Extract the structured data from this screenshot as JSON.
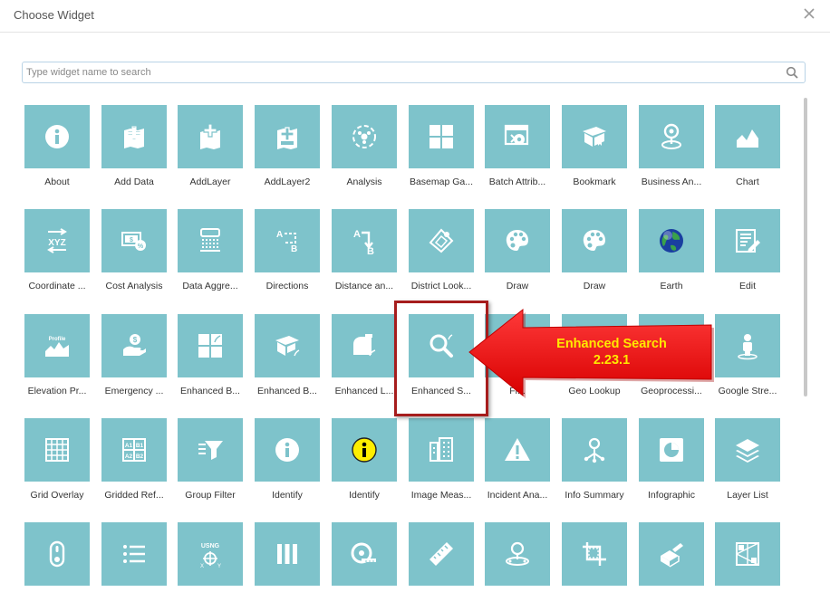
{
  "dialog": {
    "title": "Choose Widget"
  },
  "search": {
    "placeholder": "Type widget name to search"
  },
  "callout": {
    "line1": "Enhanced Search",
    "line2": "2.23.1"
  },
  "colors": {
    "tile": "#7ec3cb",
    "highlight_border": "#a61d1d",
    "arrow": "#ee1111",
    "callout_text": "#ffe900"
  },
  "widgets": [
    {
      "label": "About",
      "icon": "info-icon"
    },
    {
      "label": "Add Data",
      "icon": "add-data-map-icon"
    },
    {
      "label": "AddLayer",
      "icon": "add-layer-icon"
    },
    {
      "label": "AddLayer2",
      "icon": "add-layer2-icon"
    },
    {
      "label": "Analysis",
      "icon": "analysis-icon"
    },
    {
      "label": "Basemap Ga...",
      "icon": "basemap-gallery-icon"
    },
    {
      "label": "Batch Attrib...",
      "icon": "batch-attribute-icon"
    },
    {
      "label": "Bookmark",
      "icon": "bookmark-icon"
    },
    {
      "label": "Business An...",
      "icon": "business-analyst-icon"
    },
    {
      "label": "Chart",
      "icon": "chart-icon"
    },
    {
      "label": "Coordinate ...",
      "icon": "coordinate-xyz-icon"
    },
    {
      "label": "Cost Analysis",
      "icon": "cost-analysis-icon"
    },
    {
      "label": "Data Aggre...",
      "icon": "data-aggregation-icon"
    },
    {
      "label": "Directions",
      "icon": "directions-icon"
    },
    {
      "label": "Distance an...",
      "icon": "distance-icon"
    },
    {
      "label": "District Look...",
      "icon": "district-lookup-icon"
    },
    {
      "label": "Draw",
      "icon": "palette-icon"
    },
    {
      "label": "Draw",
      "icon": "palette-icon"
    },
    {
      "label": "Earth",
      "icon": "earth-globe-icon"
    },
    {
      "label": "Edit",
      "icon": "edit-icon"
    },
    {
      "label": "Elevation Pr...",
      "icon": "elevation-profile-icon"
    },
    {
      "label": "Emergency ...",
      "icon": "emergency-icon"
    },
    {
      "label": "Enhanced B...",
      "icon": "enhanced-basemap-icon"
    },
    {
      "label": "Enhanced B...",
      "icon": "enhanced-bookmark-icon"
    },
    {
      "label": "Enhanced L...",
      "icon": "enhanced-locate-icon"
    },
    {
      "label": "Enhanced S...",
      "icon": "enhanced-search-icon"
    },
    {
      "label": "Fi...",
      "icon": "filter-icon"
    },
    {
      "label": "Geo Lookup",
      "icon": "geo-lookup-icon"
    },
    {
      "label": "Geoprocessi...",
      "icon": "geoprocessing-icon"
    },
    {
      "label": "Google Stre...",
      "icon": "streetview-person-icon"
    },
    {
      "label": "Grid Overlay",
      "icon": "grid-overlay-icon"
    },
    {
      "label": "Gridded Ref...",
      "icon": "gridded-reference-icon"
    },
    {
      "label": "Group Filter",
      "icon": "group-filter-icon"
    },
    {
      "label": "Identify",
      "icon": "identify-icon"
    },
    {
      "label": "Identify",
      "icon": "identify-yellow-icon"
    },
    {
      "label": "Image Meas...",
      "icon": "image-measurement-icon"
    },
    {
      "label": "Incident Ana...",
      "icon": "incident-warning-icon"
    },
    {
      "label": "Info Summary",
      "icon": "info-summary-icon"
    },
    {
      "label": "Infographic",
      "icon": "infographic-icon"
    },
    {
      "label": "Layer List",
      "icon": "layer-list-icon"
    },
    {
      "label": "",
      "icon": "mouse-icon"
    },
    {
      "label": "",
      "icon": "list-icon"
    },
    {
      "label": "",
      "icon": "usng-icon"
    },
    {
      "label": "",
      "icon": "columns-icon"
    },
    {
      "label": "",
      "icon": "measure-tape-icon"
    },
    {
      "label": "",
      "icon": "ruler-icon"
    },
    {
      "label": "",
      "icon": "near-me-icon"
    },
    {
      "label": "",
      "icon": "crop-icon"
    },
    {
      "label": "",
      "icon": "parcel-drafter-icon"
    },
    {
      "label": "",
      "icon": "network-trace-icon"
    }
  ]
}
